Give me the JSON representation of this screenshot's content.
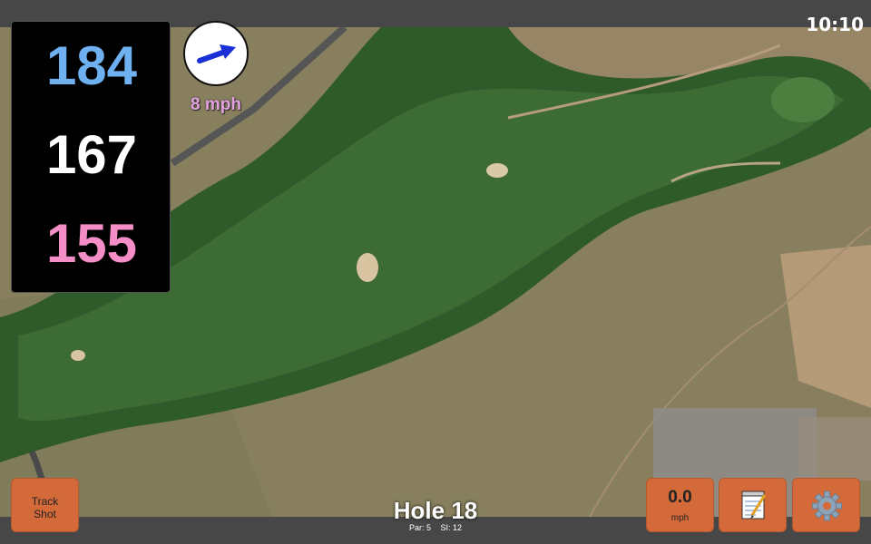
{
  "status": {
    "time": "10:10"
  },
  "distances": {
    "back": "184",
    "middle": "167",
    "front": "155"
  },
  "wind": {
    "speed_label": "8 mph",
    "direction_icon": "wind-arrow-icon"
  },
  "hole": {
    "title": "Hole 18",
    "par_label": "Par: 5",
    "si_label": "SI: 12"
  },
  "buttons": {
    "track_shot_line1": "Track",
    "track_shot_line2": "Shot",
    "speed_value": "0.0",
    "speed_unit": "mph",
    "notes_icon": "notepad-icon",
    "settings_icon": "gear-icon"
  },
  "colors": {
    "back": "#6fb0f0",
    "middle": "#ffffff",
    "front": "#f58ec6",
    "button": "#d46a3a",
    "wind_speed": "#e5a0e0"
  }
}
